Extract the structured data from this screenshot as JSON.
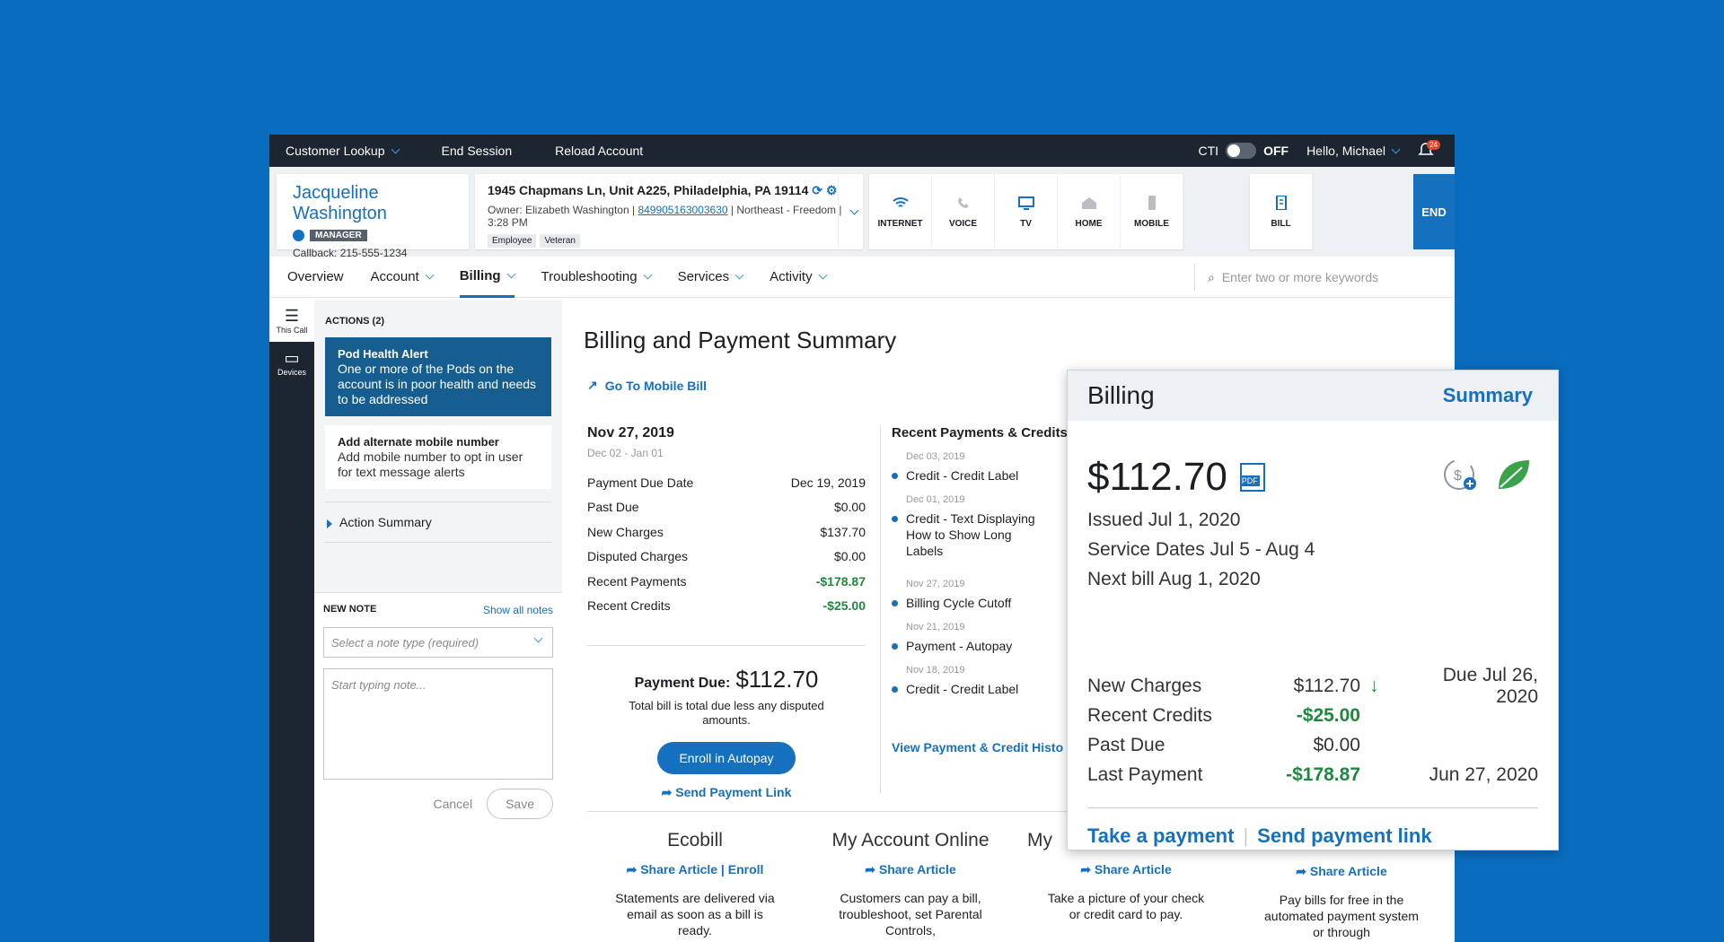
{
  "topbar": {
    "customer_lookup": "Customer Lookup",
    "end_session": "End Session",
    "reload_account": "Reload Account",
    "cti_label": "CTI",
    "cti_state": "OFF",
    "greeting": "Hello, Michael",
    "notif_count": "24"
  },
  "customer": {
    "name": "Jacqueline Washington",
    "role": "MANAGER",
    "callback": "Callback: 215-555-1234"
  },
  "account": {
    "address": "1945 Chapmans Ln, Unit A225, Philadelphia, PA 19114",
    "owner_prefix": "Owner: Elizabeth Washington |",
    "account_number": "849905163003630",
    "owner_suffix": "| Northeast - Freedom | 3:28 PM",
    "chips": [
      "Employee",
      "Veteran"
    ]
  },
  "services": [
    {
      "label": "INTERNET",
      "icon": "wifi-icon"
    },
    {
      "label": "VOICE",
      "icon": "phone-icon"
    },
    {
      "label": "TV",
      "icon": "tv-icon"
    },
    {
      "label": "HOME",
      "icon": "home-icon"
    },
    {
      "label": "MOBILE",
      "icon": "mobile-icon"
    },
    {
      "label": "BILL",
      "icon": "bill-icon"
    }
  ],
  "end_label": "END",
  "tabs": [
    "Overview",
    "Account",
    "Billing",
    "Troubleshooting",
    "Services",
    "Activity"
  ],
  "search": {
    "placeholder": "Enter two or more keywords"
  },
  "rail": {
    "this_call": "This Call",
    "devices": "Devices"
  },
  "actions": {
    "heading": "ACTIONS (2)",
    "alert_title": "Pod Health Alert",
    "alert_text": "One or more of the Pods on the account is in poor health and needs to be addressed",
    "alt_title": "Add alternate mobile number",
    "alt_text": "Add mobile number to opt in user for text message alerts",
    "summary": "Action Summary"
  },
  "note": {
    "heading": "NEW NOTE",
    "show_all": "Show all notes",
    "type_placeholder": "Select a note type (required)",
    "text_placeholder": "Start typing note...",
    "cancel": "Cancel",
    "save": "Save"
  },
  "main": {
    "title": "Billing and Payment Summary",
    "mobile_link": "Go To Mobile Bill",
    "bill_date": "Nov 27, 2019",
    "bill_range": "Dec 02 - Jan 01",
    "rows": [
      {
        "label": "Payment Due Date",
        "value": "Dec 19, 2019"
      },
      {
        "label": "Past Due",
        "value": "$0.00"
      },
      {
        "label": "New Charges",
        "value": "$137.70"
      },
      {
        "label": "Disputed Charges",
        "value": "$0.00"
      },
      {
        "label": "Recent Payments",
        "value": "-$178.87"
      },
      {
        "label": "Recent Credits",
        "value": "-$25.00"
      }
    ],
    "payment_due_label": "Payment Due:",
    "payment_due_amount": "$112.70",
    "payment_note": "Total bill is total due less any disputed amounts.",
    "enroll": "Enroll in Autopay",
    "send_link": "Send Payment Link"
  },
  "recent": {
    "heading": "Recent Payments & Credits",
    "items": [
      {
        "date": "Dec 03, 2019",
        "label": "Credit - Credit Label"
      },
      {
        "date": "Dec 01, 2019",
        "label": "Credit - Text Displaying How to Show Long Labels"
      },
      {
        "date": "Nov 27, 2019",
        "label": "Billing Cycle Cutoff"
      },
      {
        "date": "Nov 21, 2019",
        "label": "Payment - Autopay"
      },
      {
        "date": "Nov 18, 2019",
        "label": "Credit - Credit Label"
      }
    ],
    "view_link": "View Payment & Credit Histo"
  },
  "articles": [
    {
      "title": "Ecobill",
      "share": "Share Article",
      "extra": "Enroll",
      "text": "Statements are delivered via email as soon as a bill is ready."
    },
    {
      "title": "My Account Online",
      "share": "Share Article",
      "text": "Customers can pay a bill, troubleshoot, set Parental Controls,"
    },
    {
      "title": "My",
      "share": "Share Article",
      "text": "Take a picture of your check or credit card to pay."
    },
    {
      "title": "",
      "share": "Share Article",
      "text": "Pay bills for free in the automated payment system or through"
    }
  ],
  "popup": {
    "title": "Billing",
    "summary": "Summary",
    "amount": "$112.70",
    "issued": "Issued Jul 1, 2020",
    "service_dates": "Service Dates Jul 5 - Aug 4",
    "next_bill": "Next bill Aug 1, 2020",
    "new_charges_label": "New Charges",
    "new_charges": "$112.70",
    "due": "Due Jul 26, 2020",
    "credits_label": "Recent Credits",
    "credits": "-$25.00",
    "past_due_label": "Past Due",
    "past_due": "$0.00",
    "last_payment_label": "Last Payment",
    "last_payment": "-$178.87",
    "last_payment_date": "Jun 27, 2020",
    "take_payment": "Take a payment",
    "send_payment": "Send payment link",
    "pdf": "PDF"
  },
  "colors": {
    "brand": "#1670c0",
    "positive": "#1c8a3b",
    "background": "#0a6cbf"
  }
}
